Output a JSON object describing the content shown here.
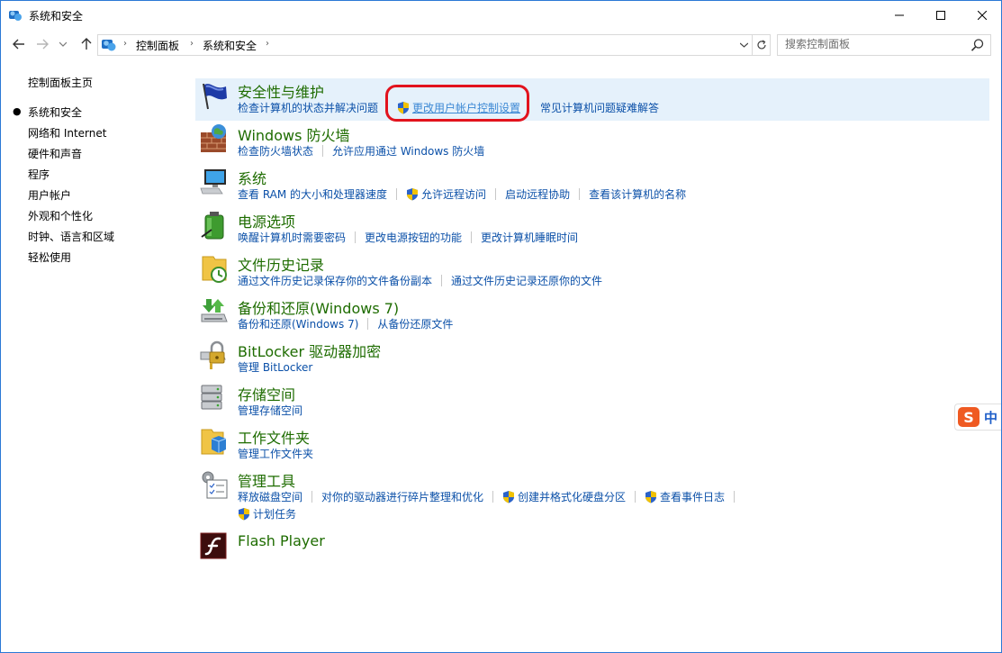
{
  "window": {
    "title": "系统和安全"
  },
  "address": {
    "crumbs": [
      "控制面板",
      "系统和安全"
    ],
    "search_placeholder": "搜索控制面板"
  },
  "sidebar": {
    "items": [
      {
        "label": "控制面板主页",
        "selected": false
      },
      {
        "label": "系统和安全",
        "selected": true
      },
      {
        "label": "网络和 Internet",
        "selected": false
      },
      {
        "label": "硬件和声音",
        "selected": false
      },
      {
        "label": "程序",
        "selected": false
      },
      {
        "label": "用户帐户",
        "selected": false
      },
      {
        "label": "外观和个性化",
        "selected": false
      },
      {
        "label": "时钟、语言和区域",
        "selected": false
      },
      {
        "label": "轻松使用",
        "selected": false
      }
    ]
  },
  "categories": [
    {
      "title": "安全性与维护",
      "icon": "flag-icon",
      "links": [
        "检查计算机的状态并解决问题",
        "更改用户帐户控制设置",
        "常见计算机问题疑难解答"
      ]
    },
    {
      "title": "Windows 防火墙",
      "icon": "firewall-icon",
      "links": [
        "检查防火墙状态",
        "允许应用通过 Windows 防火墙"
      ]
    },
    {
      "title": "系统",
      "icon": "computer-icon",
      "links": [
        "查看 RAM 的大小和处理器速度",
        "允许远程访问",
        "启动远程协助",
        "查看该计算机的名称"
      ]
    },
    {
      "title": "电源选项",
      "icon": "battery-icon",
      "links": [
        "唤醒计算机时需要密码",
        "更改电源按钮的功能",
        "更改计算机睡眠时间"
      ]
    },
    {
      "title": "文件历史记录",
      "icon": "file-history-icon",
      "links": [
        "通过文件历史记录保存你的文件备份副本",
        "通过文件历史记录还原你的文件"
      ]
    },
    {
      "title": "备份和还原(Windows 7)",
      "icon": "backup-icon",
      "links": [
        "备份和还原(Windows 7)",
        "从备份还原文件"
      ]
    },
    {
      "title": "BitLocker 驱动器加密",
      "icon": "bitlocker-icon",
      "links": [
        "管理 BitLocker"
      ]
    },
    {
      "title": "存储空间",
      "icon": "storage-icon",
      "links": [
        "管理存储空间"
      ]
    },
    {
      "title": "工作文件夹",
      "icon": "work-folder-icon",
      "links": [
        "管理工作文件夹"
      ]
    },
    {
      "title": "管理工具",
      "icon": "admin-tools-icon",
      "links": [
        "释放磁盘空间",
        "对你的驱动器进行碎片整理和优化",
        "创建并格式化硬盘分区",
        "查看事件日志",
        "计划任务"
      ]
    },
    {
      "title": "Flash Player",
      "icon": "flash-icon",
      "links": []
    }
  ],
  "ime": {
    "label": "中",
    "logo": "S"
  },
  "colors": {
    "category_title": "#1e6c00",
    "link": "#0b50a8",
    "highlight": "#e5f1fb",
    "annotation": "#e2131d"
  }
}
